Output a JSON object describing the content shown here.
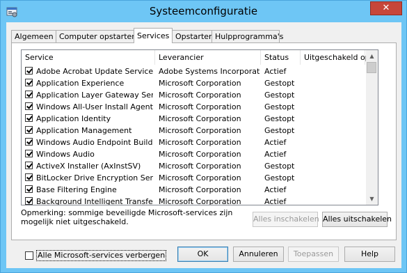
{
  "window": {
    "title": "Systeemconfiguratie",
    "close_glyph": "✕"
  },
  "tabs": [
    {
      "label": "Algemeen",
      "active": false
    },
    {
      "label": "Computer opstarten",
      "active": false
    },
    {
      "label": "Services",
      "active": true
    },
    {
      "label": "Opstarten",
      "active": false
    },
    {
      "label": "Hulpprogramma's",
      "active": false
    }
  ],
  "columns": {
    "service": "Service",
    "vendor": "Leverancier",
    "status": "Status",
    "disabled_on": "Uitgeschakeld op"
  },
  "services": [
    {
      "checked": true,
      "name": "Adobe Acrobat Update Service",
      "vendor": "Adobe Systems Incorporated",
      "status": "Actief"
    },
    {
      "checked": true,
      "name": "Application Experience",
      "vendor": "Microsoft Corporation",
      "status": "Gestopt"
    },
    {
      "checked": true,
      "name": "Application Layer Gateway Service",
      "vendor": "Microsoft Corporation",
      "status": "Gestopt"
    },
    {
      "checked": true,
      "name": "Windows All-User Install Agent",
      "vendor": "Microsoft Corporation",
      "status": "Gestopt"
    },
    {
      "checked": true,
      "name": "Application Identity",
      "vendor": "Microsoft Corporation",
      "status": "Gestopt"
    },
    {
      "checked": true,
      "name": "Application Management",
      "vendor": "Microsoft Corporation",
      "status": "Gestopt"
    },
    {
      "checked": true,
      "name": "Windows Audio Endpoint Builder",
      "vendor": "Microsoft Corporation",
      "status": "Actief"
    },
    {
      "checked": true,
      "name": "Windows Audio",
      "vendor": "Microsoft Corporation",
      "status": "Actief"
    },
    {
      "checked": true,
      "name": "ActiveX Installer (AxInstSV)",
      "vendor": "Microsoft Corporation",
      "status": "Gestopt"
    },
    {
      "checked": true,
      "name": "BitLocker Drive Encryption Service",
      "vendor": "Microsoft Corporation",
      "status": "Gestopt"
    },
    {
      "checked": true,
      "name": "Base Filtering Engine",
      "vendor": "Microsoft Corporation",
      "status": "Actief"
    },
    {
      "checked": true,
      "name": "Background Intelligent Transfer ...",
      "vendor": "Microsoft Corporation",
      "status": "Actief"
    }
  ],
  "note": "Opmerking: sommige beveiligde Microsoft-services zijn mogelijk niet uitgeschakeld.",
  "buttons": {
    "enable_all": "Alles inschakelen",
    "disable_all": "Alles uitschakelen",
    "ok": "OK",
    "cancel": "Annuleren",
    "apply": "Toepassen",
    "help": "Help"
  },
  "hide_ms": {
    "label": "Alle Microsoft-services verbergen",
    "checked": false
  },
  "icons": {
    "app": "msconfig-icon",
    "scroll_up": "▲",
    "scroll_down": "▼"
  }
}
